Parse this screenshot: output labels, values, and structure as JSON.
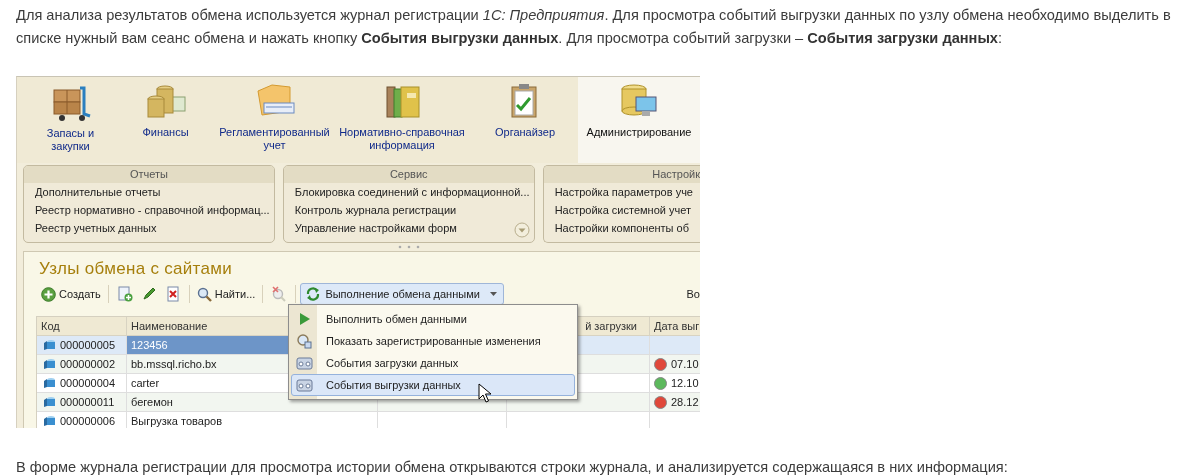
{
  "intro": "Для анализа результатов обмена используется журнал регистрации *1С: Предприятия*. Для просмотра событий выгрузки данных по узлу обмена необходимо выделить в списке нужный вам сеанс обмена и нажать кнопку **События выгрузки данных**. Для просмотра событий загрузки – **События загрузки данных**:",
  "screenshot": {
    "sections": [
      {
        "label": "Запасы и закупки",
        "selected": false
      },
      {
        "label": "Финансы",
        "selected": false
      },
      {
        "label": "Регламентированный учет",
        "selected": false
      },
      {
        "label": "Нормативно-справочная информация",
        "selected": false
      },
      {
        "label": "Органайзер",
        "selected": false
      },
      {
        "label": "Администрирование",
        "selected": true
      }
    ],
    "panels": [
      {
        "title": "Отчеты",
        "items": [
          "Дополнительные отчеты",
          "Реестр нормативно - справочной информац...",
          "Реестр учетных данных"
        ]
      },
      {
        "title": "Сервис",
        "items": [
          "Блокировка соединений с информационной...",
          "Контроль журнала регистрации",
          "Управление настройками форм"
        ],
        "more_button": true
      },
      {
        "title": "Настройк",
        "items": [
          "Настройка параметров уче",
          "Настройка системной учет",
          "Настройки компоненты об"
        ]
      }
    ],
    "form": {
      "title": "Узлы обмена с сайтами",
      "toolbar": {
        "create": "Создать",
        "find": "Найти...",
        "exchange": "Выполнение обмена данными",
        "cut_label": "Во"
      },
      "columns": [
        {
          "label": "Код"
        },
        {
          "label": "Наименование"
        },
        {},
        {
          "label": "й загрузки"
        },
        {
          "label": "Дата выг"
        }
      ],
      "rows": [
        {
          "code": "000000005",
          "name": "123456",
          "selected": true
        },
        {
          "code": "000000002",
          "name": "bb.mssql.richo.bx",
          "selected": false,
          "color": "#e0483a",
          "date": "07.10"
        },
        {
          "code": "000000004",
          "name": "carter",
          "selected": false,
          "color": "#5cb85c",
          "date": "12.10"
        },
        {
          "code": "000000011",
          "name": "бегемон",
          "selected": false,
          "color": "#e0483a",
          "date": "28.12"
        },
        {
          "code": "000000006",
          "name": "Выгрузка товаров",
          "selected": false
        }
      ],
      "menu": [
        {
          "label": "Выполнить обмен данными",
          "selected": false
        },
        {
          "label": "Показать зарегистрированные изменения",
          "selected": false
        },
        {
          "label": "События загрузки данных",
          "selected": false
        },
        {
          "label": "События выгрузки данных",
          "selected": true
        }
      ]
    }
  },
  "outro": "В форме журнала регистрации для просмотра истории обмена открываются строки журнала, и анализируется содержащаяся в них информация:"
}
